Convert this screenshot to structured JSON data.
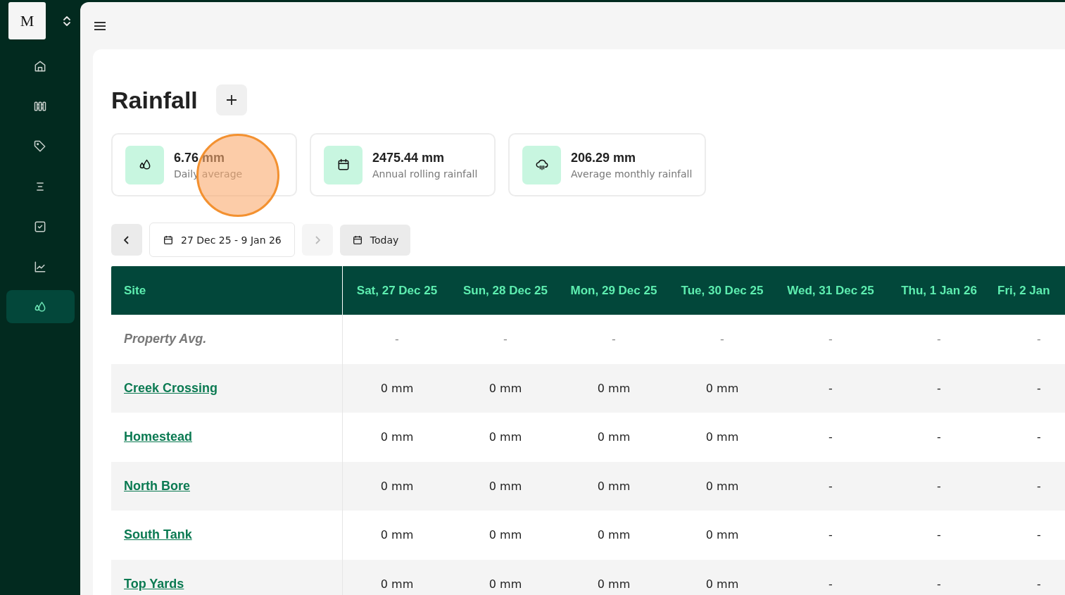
{
  "logo": {
    "letter": "M"
  },
  "sidebar": {
    "items": [
      {
        "selected": false
      },
      {
        "selected": false
      },
      {
        "selected": false
      },
      {
        "selected": false
      },
      {
        "selected": false
      },
      {
        "selected": false
      },
      {
        "selected": true
      }
    ]
  },
  "page": {
    "title": "Rainfall"
  },
  "stats": [
    {
      "value": "6.76 mm",
      "label": "Daily average"
    },
    {
      "value": "2475.44 mm",
      "label": "Annual rolling rainfall"
    },
    {
      "value": "206.29 mm",
      "label": "Average monthly rainfall"
    }
  ],
  "date_nav": {
    "range": "27 Dec 25 - 9 Jan 26",
    "today": "Today",
    "next_disabled": true
  },
  "table": {
    "columns": [
      "Site",
      "Sat, 27 Dec 25",
      "Sun, 28 Dec 25",
      "Mon, 29 Dec 25",
      "Tue, 30 Dec 25",
      "Wed, 31 Dec 25",
      "Thu, 1 Jan 26",
      "Fri, 2 Jan"
    ],
    "rows": [
      {
        "kind": "summary",
        "cells": [
          "Property Avg.",
          "-",
          "-",
          "-",
          "-",
          "-",
          "-",
          "-"
        ]
      },
      {
        "kind": "site",
        "cells": [
          "Creek Crossing",
          "0 mm",
          "0 mm",
          "0 mm",
          "0 mm",
          "-",
          "-",
          "-"
        ]
      },
      {
        "kind": "site",
        "cells": [
          "Homestead",
          "0 mm",
          "0 mm",
          "0 mm",
          "0 mm",
          "-",
          "-",
          "-"
        ]
      },
      {
        "kind": "site",
        "cells": [
          "North Bore",
          "0 mm",
          "0 mm",
          "0 mm",
          "0 mm",
          "-",
          "-",
          "-"
        ]
      },
      {
        "kind": "site",
        "cells": [
          "South Tank",
          "0 mm",
          "0 mm",
          "0 mm",
          "0 mm",
          "-",
          "-",
          "-"
        ]
      },
      {
        "kind": "site",
        "cells": [
          "Top Yards",
          "0 mm",
          "0 mm",
          "0 mm",
          "0 mm",
          "-",
          "-",
          "-"
        ]
      }
    ]
  }
}
